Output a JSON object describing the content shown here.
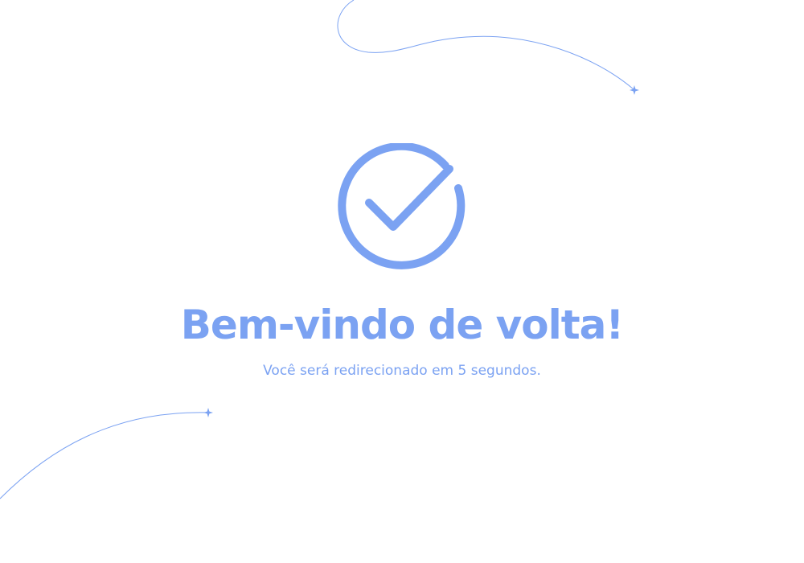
{
  "success": {
    "icon": "check-circle-icon",
    "title": "Bem-vindo de volta!",
    "subtitle": "Você será redirecionado em 5 segundos."
  },
  "colors": {
    "accent": "#7ba2f2",
    "decoration": "#7ba2f2",
    "background": "#ffffff"
  }
}
